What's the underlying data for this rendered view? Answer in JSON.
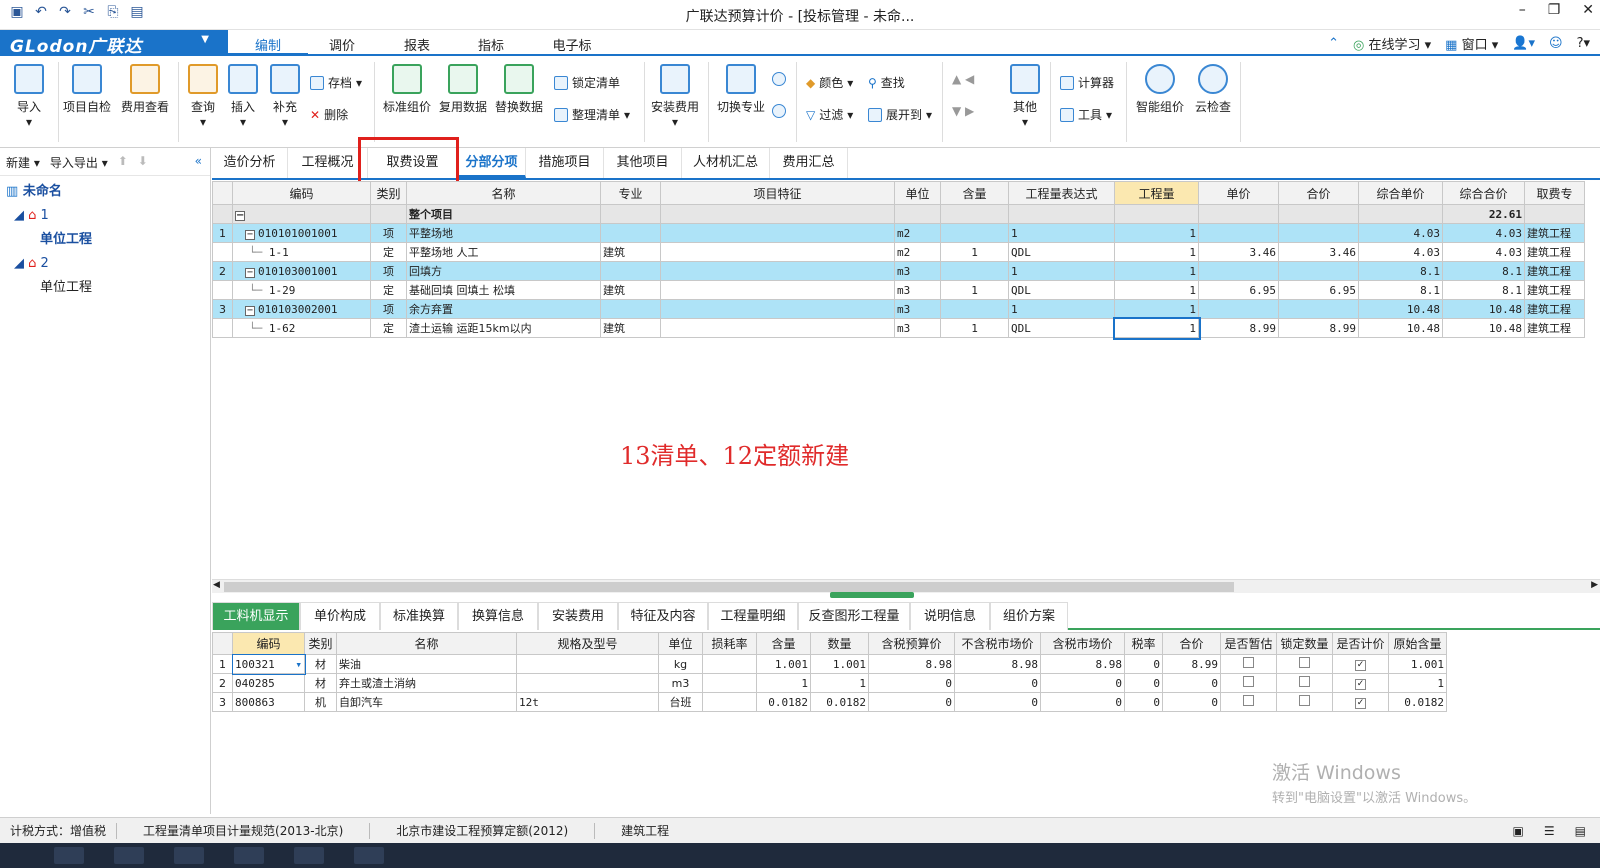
{
  "titlebar": {
    "title": "广联达预算计价 - [投标管理 - 未命...",
    "qat_icons": [
      "save-icon",
      "undo-icon",
      "redo-icon",
      "cut-icon",
      "copy-icon",
      "paste-icon"
    ]
  },
  "menubar": {
    "brand": "GLodon广联达",
    "tabs": [
      "编制",
      "调价",
      "报表",
      "指标",
      "电子标"
    ],
    "active": "编制",
    "online": "在线学习",
    "window": "窗口"
  },
  "ribbon": {
    "import": "导入",
    "self_check": "项目自检",
    "fee_view": "费用查看",
    "query": "查询",
    "insert": "插入",
    "supplement": "补充",
    "archive": "存档",
    "delete": "删除",
    "std_price": "标准组价",
    "reuse": "复用数据",
    "replace": "替换数据",
    "lock_list": "锁定清单",
    "tidy_list": "整理清单",
    "install_fee": "安装费用",
    "switch_major": "切换专业",
    "color": "颜色",
    "find": "查找",
    "filter": "过滤",
    "expand": "展开到",
    "other": "其他",
    "calculator": "计算器",
    "tools": "工具",
    "smart_price": "智能组价",
    "cloud_check": "云检查"
  },
  "left": {
    "new": "新建",
    "import_export": "导入导出",
    "root": "未命名",
    "tree": [
      {
        "label": "1",
        "child": "单位工程",
        "selected": true
      },
      {
        "label": "2",
        "child": "单位工程",
        "selected": false
      }
    ]
  },
  "tabs1": [
    "造价分析",
    "工程概况",
    "取费设置",
    "分部分项",
    "措施项目",
    "其他项目",
    "人材机汇总",
    "费用汇总"
  ],
  "tabs1_active": "分部分项",
  "grid1": {
    "headers": [
      "编码",
      "类别",
      "名称",
      "专业",
      "项目特征",
      "单位",
      "含量",
      "工程量表达式",
      "工程量",
      "单价",
      "合价",
      "综合单价",
      "综合合价",
      "取费专"
    ],
    "whole": {
      "name": "整个项目",
      "total": "22.61"
    },
    "rows": [
      {
        "no": "1",
        "code": "010101001001",
        "type": "项",
        "name": "平整场地",
        "major": "",
        "unit": "m2",
        "content": "",
        "expr": "1",
        "qty": "1",
        "price": "",
        "sum": "",
        "uprice": "4.03",
        "usum": "4.03",
        "fee": "建筑工程",
        "kind": "qd"
      },
      {
        "no": "",
        "code": "1-1",
        "type": "定",
        "name": "平整场地 人工",
        "major": "建筑",
        "unit": "m2",
        "content": "1",
        "expr": "QDL",
        "qty": "1",
        "price": "3.46",
        "sum": "3.46",
        "uprice": "4.03",
        "usum": "4.03",
        "fee": "建筑工程",
        "kind": "de"
      },
      {
        "no": "2",
        "code": "010103001001",
        "type": "项",
        "name": "回填方",
        "major": "",
        "unit": "m3",
        "content": "",
        "expr": "1",
        "qty": "1",
        "price": "",
        "sum": "",
        "uprice": "8.1",
        "usum": "8.1",
        "fee": "建筑工程",
        "kind": "qd"
      },
      {
        "no": "",
        "code": "1-29",
        "type": "定",
        "name": "基础回填 回填土 松填",
        "major": "建筑",
        "unit": "m3",
        "content": "1",
        "expr": "QDL",
        "qty": "1",
        "price": "6.95",
        "sum": "6.95",
        "uprice": "8.1",
        "usum": "8.1",
        "fee": "建筑工程",
        "kind": "de"
      },
      {
        "no": "3",
        "code": "010103002001",
        "type": "项",
        "name": "余方弃置",
        "major": "",
        "unit": "m3",
        "content": "",
        "expr": "1",
        "qty": "1",
        "price": "",
        "sum": "",
        "uprice": "10.48",
        "usum": "10.48",
        "fee": "建筑工程",
        "kind": "qd"
      },
      {
        "no": "",
        "code": "1-62",
        "type": "定",
        "name": "渣土运输 运距15km以内",
        "major": "建筑",
        "unit": "m3",
        "content": "1",
        "expr": "QDL",
        "qty": "1",
        "price": "8.99",
        "sum": "8.99",
        "uprice": "10.48",
        "usum": "10.48",
        "fee": "建筑工程",
        "kind": "de"
      }
    ]
  },
  "center_note": "13清单、12定额新建",
  "tabs2": [
    "工料机显示",
    "单价构成",
    "标准换算",
    "换算信息",
    "安装费用",
    "特征及内容",
    "工程量明细",
    "反查图形工程量",
    "说明信息",
    "组价方案"
  ],
  "tabs2_active": "工料机显示",
  "grid2": {
    "headers": [
      "编码",
      "类别",
      "名称",
      "规格及型号",
      "单位",
      "损耗率",
      "含量",
      "数量",
      "含税预算价",
      "不含税市场价",
      "含税市场价",
      "税率",
      "合价",
      "是否暂估",
      "锁定数量",
      "是否计价",
      "原始含量"
    ],
    "rows": [
      {
        "no": "1",
        "code": "100321",
        "type": "材",
        "name": "柴油",
        "spec": "",
        "unit": "kg",
        "loss": "",
        "content": "1.001",
        "qty": "1.001",
        "p1": "8.98",
        "p2": "8.98",
        "p3": "8.98",
        "tax": "0",
        "sum": "8.99",
        "est": false,
        "lock": false,
        "priced": true,
        "orig": "1.001"
      },
      {
        "no": "2",
        "code": "040285",
        "type": "材",
        "name": "弃土或渣土消纳",
        "spec": "",
        "unit": "m3",
        "loss": "",
        "content": "1",
        "qty": "1",
        "p1": "0",
        "p2": "0",
        "p3": "0",
        "tax": "0",
        "sum": "0",
        "est": false,
        "lock": false,
        "priced": true,
        "orig": "1"
      },
      {
        "no": "3",
        "code": "800863",
        "type": "机",
        "name": "自卸汽车",
        "spec": "12t",
        "unit": "台班",
        "loss": "",
        "content": "0.0182",
        "qty": "0.0182",
        "p1": "0",
        "p2": "0",
        "p3": "0",
        "tax": "0",
        "sum": "0",
        "est": false,
        "lock": false,
        "priced": true,
        "orig": "0.0182"
      }
    ]
  },
  "watermark": {
    "line1": "激活 Windows",
    "line2": "转到\"电脑设置\"以激活 Windows。"
  },
  "status": [
    "计税方式：增值税",
    "工程量清单项目计量规范(2013-北京)",
    "北京市建设工程预算定额(2012)",
    "建筑工程"
  ],
  "colors": {
    "accent": "#1a73c9",
    "green": "#3aa35c",
    "highlight": "#e0201c",
    "qd_row": "#aee3f7"
  }
}
